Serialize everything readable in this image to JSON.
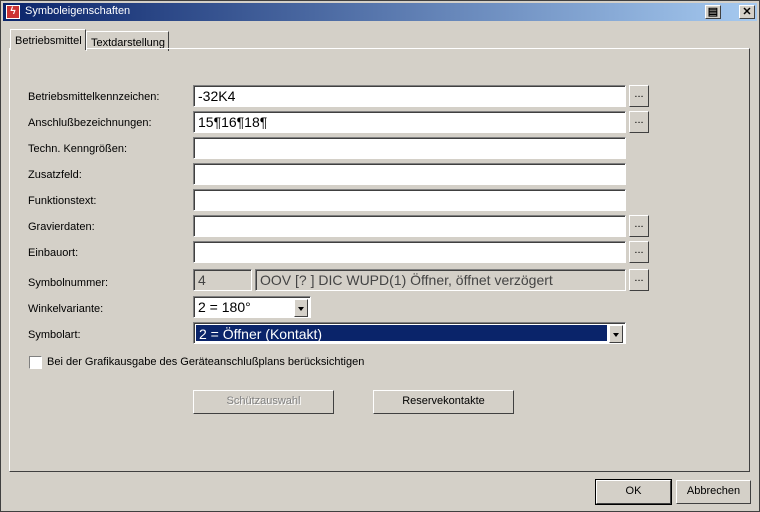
{
  "window": {
    "title": "Symboleigenschaften"
  },
  "tabs": [
    {
      "label": "Betriebsmittel",
      "active": true
    },
    {
      "label": "Textdarstellung",
      "active": false
    }
  ],
  "fields": {
    "betriebsmittelkennzeichen": {
      "label": "Betriebsmittelkennzeichen:",
      "value": "-32K4"
    },
    "anschlussbezeichnungen": {
      "label": "Anschlußbezeichnungen:",
      "value": "15¶16¶18¶"
    },
    "techn_kenngroessen": {
      "label": "Techn. Kenngrößen:",
      "value": ""
    },
    "zusatzfeld": {
      "label": "Zusatzfeld:",
      "value": ""
    },
    "funktionstext": {
      "label": "Funktionstext:",
      "value": ""
    },
    "gravierdaten": {
      "label": "Gravierdaten:",
      "value": ""
    },
    "einbauort": {
      "label": "Einbauort:",
      "value": ""
    },
    "symbolnummer": {
      "label": "Symbolnummer:",
      "number": "4",
      "description": "OOV [?  ] DIC  WUPD(1) Öffner, öffnet verzögert"
    },
    "winkelvariante": {
      "label": "Winkelvariante:",
      "value": "2 = 180°"
    },
    "symbolart": {
      "label": "Symbolart:",
      "value": "2 = Öffner (Kontakt)"
    }
  },
  "ellipsis": "...",
  "checkbox": {
    "label": "Bei der Grafikausgabe des Geräteanschlußplans berücksichtigen",
    "checked": false
  },
  "buttons": {
    "schuetzauswahl": "Schützauswahl",
    "reservekontakte": "Reservekontakte",
    "ok": "OK",
    "abbrechen": "Abbrechen"
  },
  "titlebar_buttons": {
    "close": "✕"
  },
  "colors": {
    "selection": "#0a246a",
    "title_start": "#0a246a",
    "title_end": "#a6caf0"
  }
}
